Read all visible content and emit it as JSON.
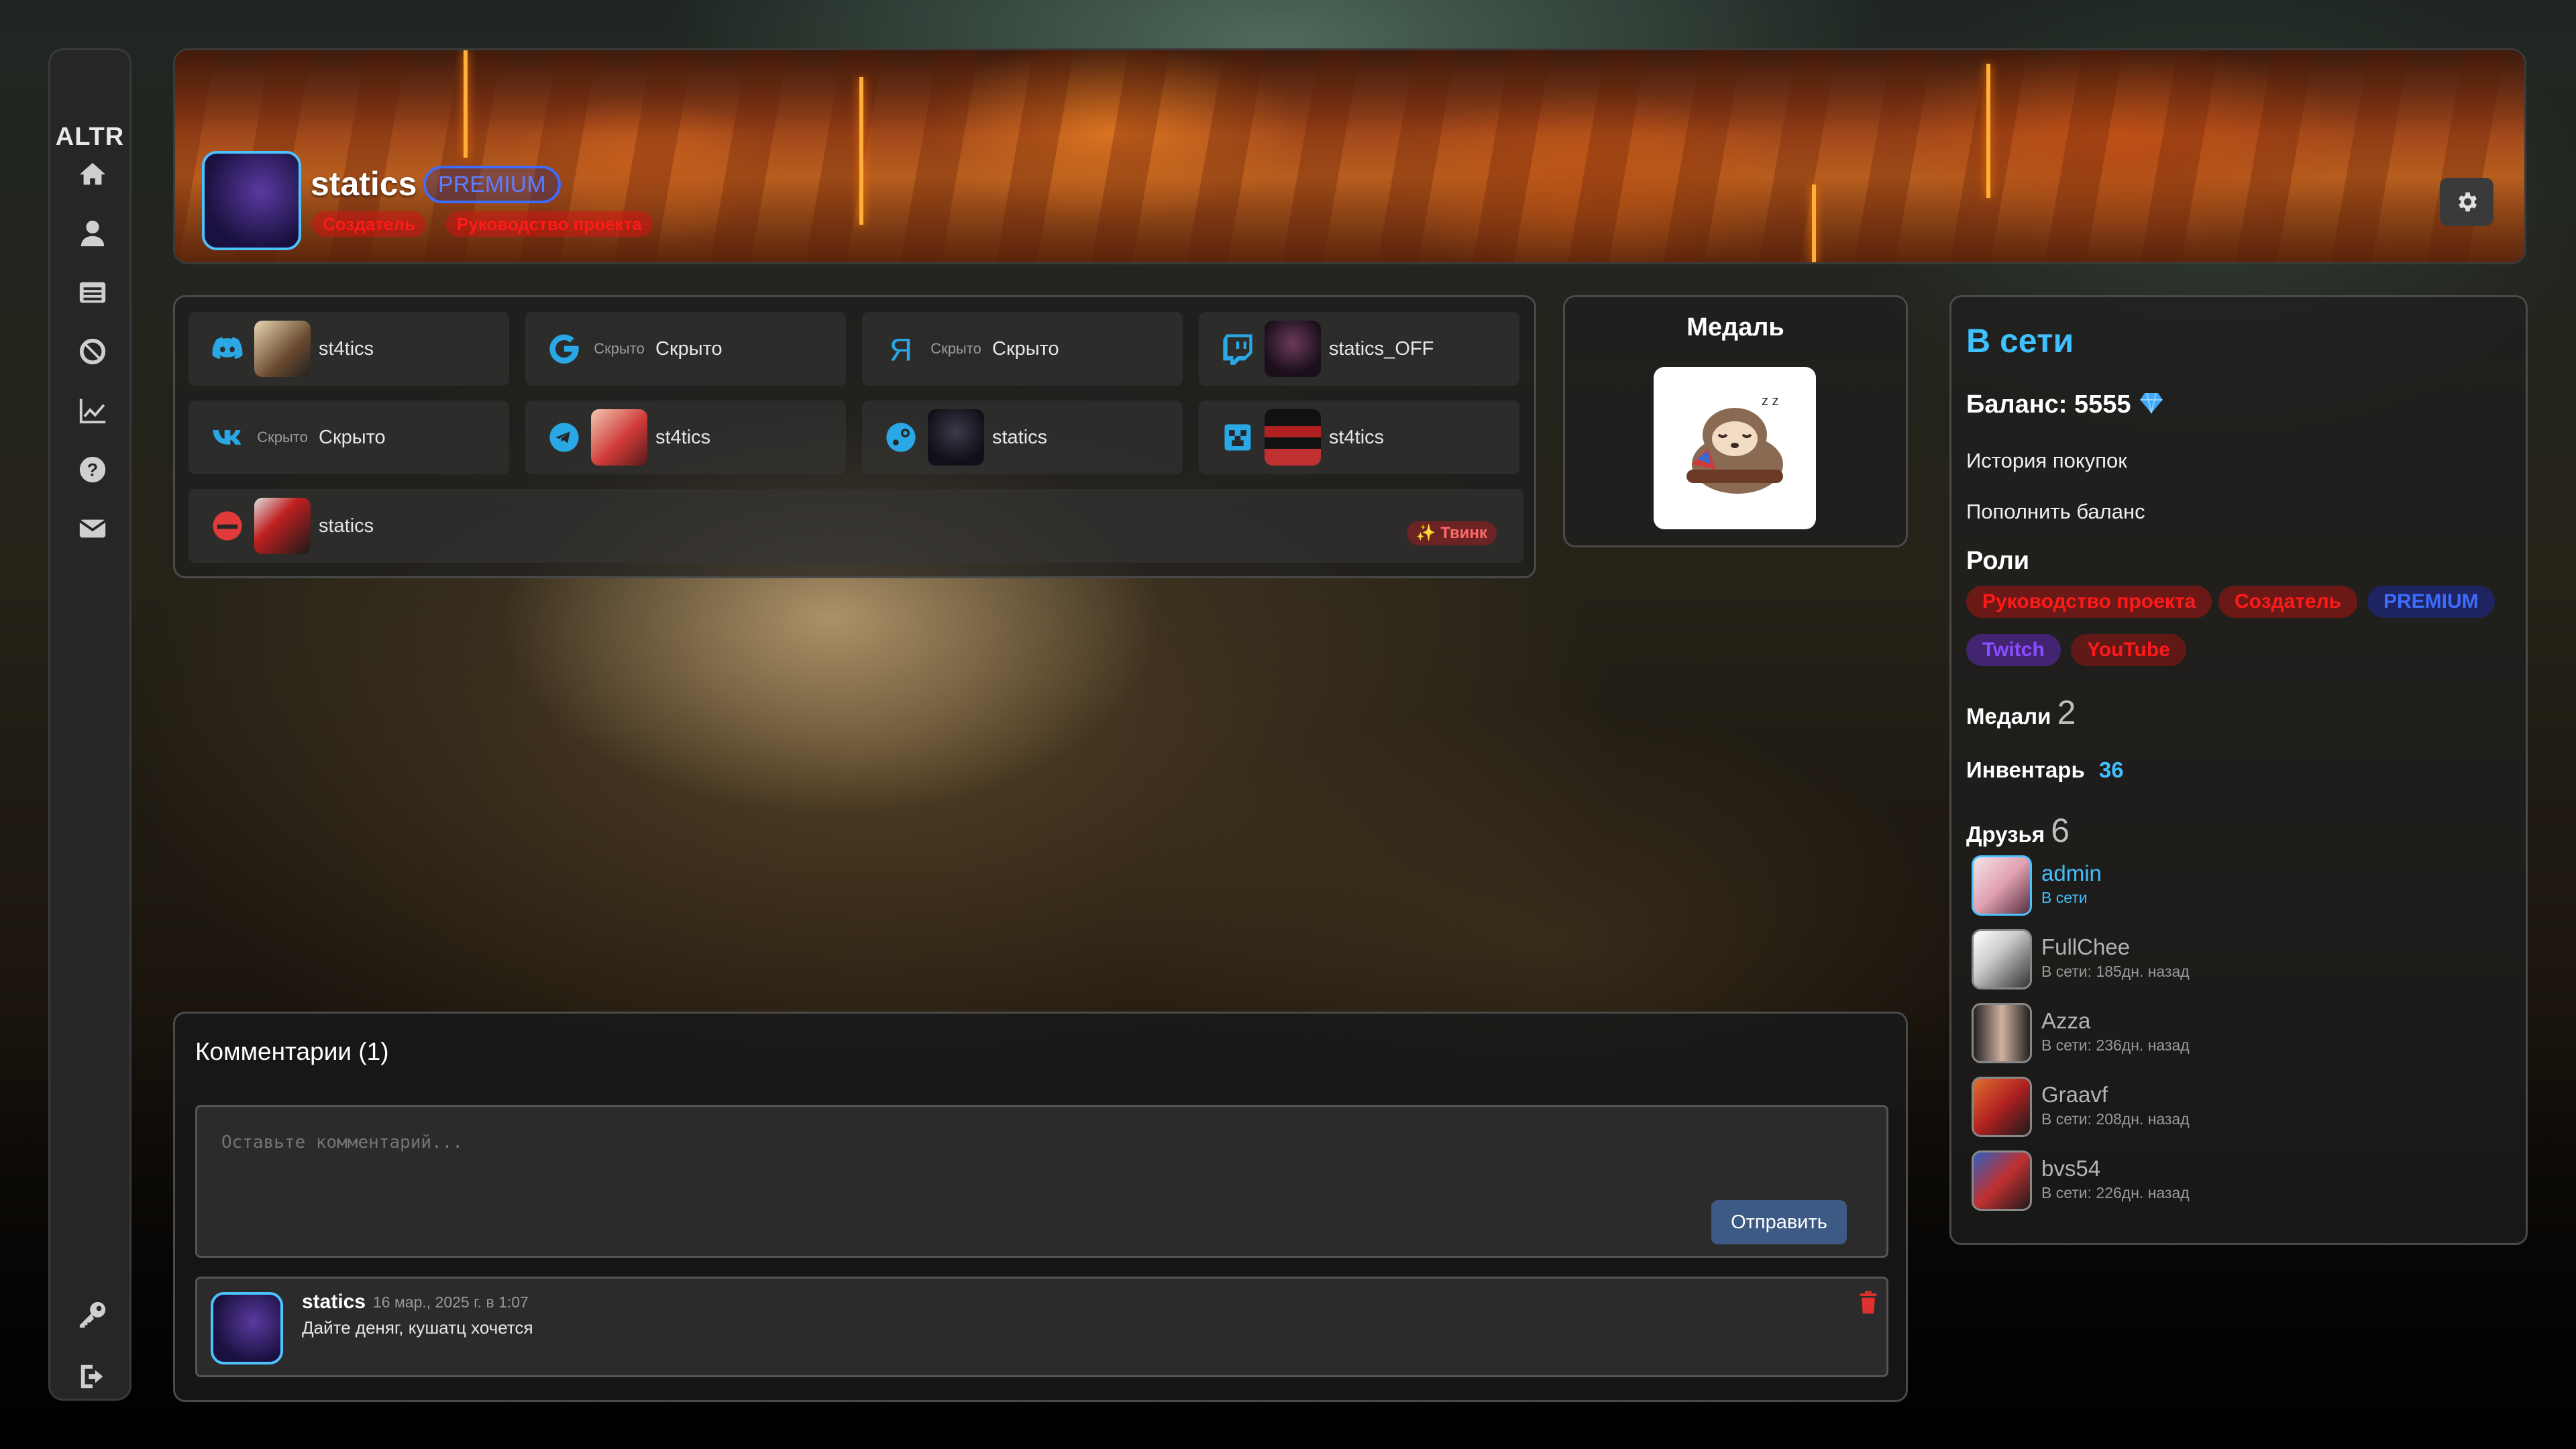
{
  "sidebar": {
    "logo": "ALTR",
    "icons": [
      "home-icon",
      "user-icon",
      "list-icon",
      "ban-icon",
      "chart-icon",
      "help-icon",
      "mail-icon",
      "key-icon",
      "logout-icon"
    ]
  },
  "banner": {
    "name": "statics",
    "premium": "PREMIUM",
    "roles": [
      "Создатель",
      "Руководство проекта"
    ]
  },
  "socials": [
    {
      "service": "discord-icon",
      "text": "st4tics",
      "hidden_label": ""
    },
    {
      "service": "google-icon",
      "text": "Скрыто",
      "hidden_label": "Скрыто"
    },
    {
      "service": "yandex-icon",
      "text": "Скрыто",
      "hidden_label": "Скрыто"
    },
    {
      "service": "twitch-icon",
      "text": "statics_OFF",
      "hidden_label": ""
    },
    {
      "service": "vk-icon",
      "text": "Скрыто",
      "hidden_label": "Скрыто"
    },
    {
      "service": "telegram-icon",
      "text": "st4tics",
      "hidden_label": ""
    },
    {
      "service": "steam-icon",
      "text": "statics",
      "hidden_label": ""
    },
    {
      "service": "minecraft-icon",
      "text": "st4tics",
      "hidden_label": ""
    },
    {
      "service": "esports-icon",
      "text": "statics",
      "hidden_label": ""
    }
  ],
  "twink": "✨ Твинк",
  "medal": {
    "title": "Медаль"
  },
  "profile": {
    "status": "В сети",
    "balance_label": "Баланс:",
    "balance_value": "5555",
    "history": "История покупок",
    "topup": "Пополнить баланс",
    "roles_title": "Роли",
    "roles": [
      "Руководство проекта",
      "Создатель",
      "PREMIUM",
      "Twitch",
      "YouTube"
    ],
    "medals_label": "Медали",
    "medals_count": "2",
    "inventory_label": "Инвентарь",
    "inventory_count": "36",
    "friends_label": "Друзья",
    "friends_count": "6",
    "friends": [
      {
        "name": "admin",
        "status": "В сети"
      },
      {
        "name": "FullChee",
        "status": "В сети: 185дн. назад"
      },
      {
        "name": "Azza",
        "status": "В сети: 236дн. назад"
      },
      {
        "name": "Graavf",
        "status": "В сети: 208дн. назад"
      },
      {
        "name": "bvs54",
        "status": "В сети: 226дн. назад"
      }
    ]
  },
  "comments": {
    "title": "Комментарии (1)",
    "placeholder": "Оставьте комментарий...",
    "send": "Отправить",
    "items": [
      {
        "author": "statics",
        "date": "16 мар., 2025 г. в 1:07",
        "text": "Дайте деняг, кушатц хочется"
      }
    ]
  },
  "colors": {
    "accent": "#3fc0ff",
    "role_red": "#ff1a1a",
    "premium_blue": "#3d6cff",
    "twitch_purple": "#8a4dff"
  }
}
